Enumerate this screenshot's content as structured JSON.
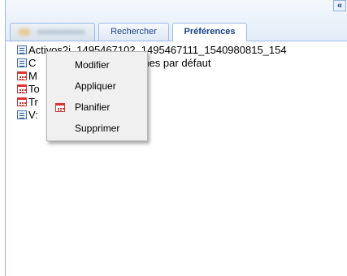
{
  "header": {
    "collapse_glyph": "«",
    "tabs": [
      {
        "label": "",
        "state": "blurred"
      },
      {
        "label": "Rechercher",
        "state": "inactive"
      },
      {
        "label": "Préférences",
        "state": "active"
      }
    ]
  },
  "tree": {
    "items": [
      {
        "icon": "list-icon",
        "label": "Activos2i_1495467102_1495467111_1540980815_154"
      },
      {
        "icon": "list-icon",
        "label": "Colonnes par défaut"
      },
      {
        "icon": "calendar-icon",
        "label": "M"
      },
      {
        "icon": "calendar-icon",
        "label": "To"
      },
      {
        "icon": "calendar-icon",
        "label": "Tr"
      },
      {
        "icon": "list-icon",
        "label": "V"
      }
    ],
    "visible_fragments": [
      "Activos2i_1495467102_1495467111_1540980815_154",
      "C",
      "lonnes par défaut",
      "M",
      "To",
      "Tr",
      "V:"
    ]
  },
  "context_menu": {
    "items": [
      {
        "label": "Modifier",
        "icon": ""
      },
      {
        "label": "Appliquer",
        "icon": ""
      },
      {
        "label": "Planifier",
        "icon": "calendar-icon"
      },
      {
        "label": "Supprimer",
        "icon": ""
      }
    ]
  },
  "colors": {
    "panel_border": "#99bbe8",
    "tab_text": "#15428b",
    "menu_bg": "#f0f0f0"
  }
}
